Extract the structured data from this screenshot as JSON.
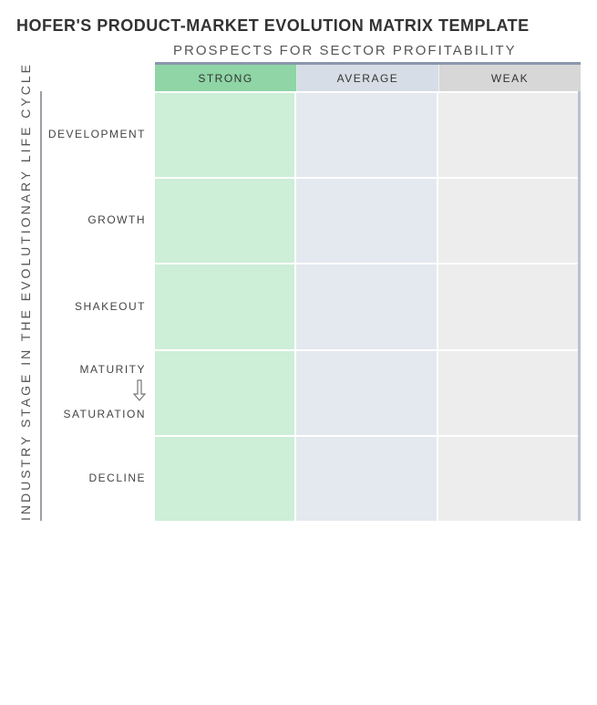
{
  "title": "HOFER'S PRODUCT-MARKET EVOLUTION MATRIX TEMPLATE",
  "axes": {
    "x_label": "PROSPECTS FOR SECTOR PROFITABILITY",
    "y_label": "INDUSTRY STAGE IN THE EVOLUTIONARY LIFE CYCLE"
  },
  "columns": {
    "strong": {
      "label": "STRONG"
    },
    "average": {
      "label": "AVERAGE"
    },
    "weak": {
      "label": "WEAK"
    }
  },
  "rows": {
    "development": {
      "label": "DEVELOPMENT"
    },
    "growth": {
      "label": "GROWTH"
    },
    "shakeout": {
      "label": "SHAKEOUT"
    },
    "maturity": {
      "label_top": "MATURITY",
      "label_bottom": "SATURATION"
    },
    "decline": {
      "label": "DECLINE"
    }
  },
  "colors": {
    "header_strong": "#8fd5a6",
    "header_average": "#d7dde6",
    "header_weak": "#d7d7d7",
    "cell_strong": "#cdeed7",
    "cell_average": "#e4e8ef",
    "cell_weak": "#ededed",
    "frame_top": "#8a97ad",
    "frame_right": "#b9c2d1"
  }
}
